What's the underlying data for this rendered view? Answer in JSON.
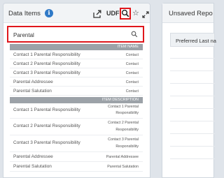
{
  "data_items_panel": {
    "title": "Data Items",
    "info_icon_glyph": "i",
    "udf_label": "UDF",
    "icons": [
      "info-icon",
      "share-icon",
      "search-icon",
      "star-icon",
      "expand-icon"
    ]
  },
  "search": {
    "value": "Parental"
  },
  "results": {
    "item_name_header": "ITEM NAME",
    "item_description_header": "ITEM DESCRIPTION",
    "by_name": [
      {
        "name": "Contact 1 Parental Responsibility",
        "type": "Contact"
      },
      {
        "name": "Contact 2 Parental Responsibility",
        "type": "Contact"
      },
      {
        "name": "Contact 3 Parental Responsibility",
        "type": "Contact"
      },
      {
        "name": "Parental Addressee",
        "type": "Contact"
      },
      {
        "name": "Parental Salutation",
        "type": "Contact"
      }
    ],
    "by_description": [
      {
        "name": "Contact 1 Parental Responsibility",
        "desc_line1": "Contact 1 Parental",
        "desc_line2": "Responsibility"
      },
      {
        "name": "Contact 2 Parental Responsibility",
        "desc_line1": "Contact 2 Parental",
        "desc_line2": "Responsibility"
      },
      {
        "name": "Contact 3 Parental Responsibility",
        "desc_line1": "Contact 3 Parental",
        "desc_line2": "Responsibility"
      },
      {
        "name": "Parental Addressee",
        "desc_line1": "Parental Addressee"
      },
      {
        "name": "Parental Salutation",
        "desc_line1": "Parental Salutation"
      }
    ]
  },
  "unsaved_panel": {
    "title": "Unsaved Repo",
    "column_label": "Preferred Last na"
  },
  "colors": {
    "highlight_red": "#e0171c",
    "info_blue": "#2f79c7",
    "section_bar_gray": "#9ca2a8"
  }
}
